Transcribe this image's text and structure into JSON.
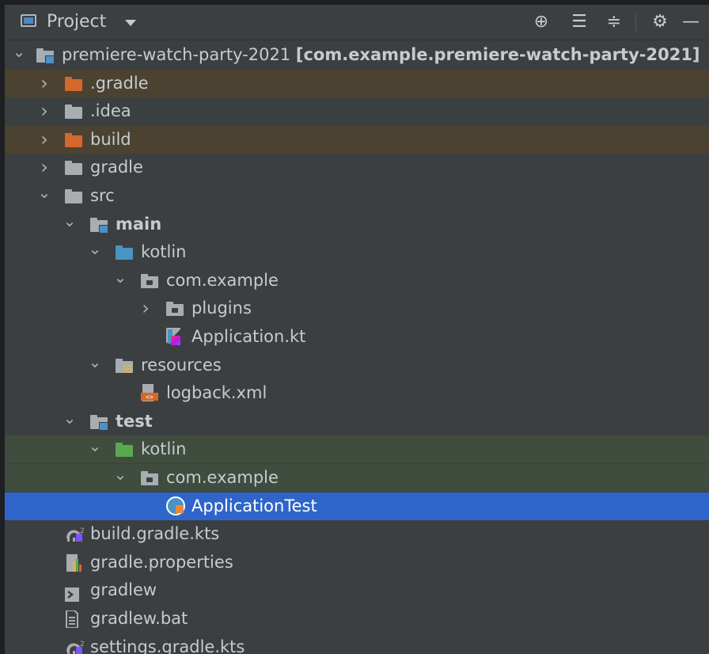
{
  "panel": {
    "title": "Project",
    "toolbar_icons": [
      "target-icon",
      "expand-all-icon",
      "collapse-all-icon",
      "gear-icon",
      "minimize-icon"
    ],
    "toolbar_glyphs": [
      "⊕",
      "☰",
      "≑",
      "⚙",
      "—"
    ]
  },
  "tree": [
    {
      "name": "premiere-watch-party-2021",
      "suffix": "[com.example.premiere-watch-party-2021]",
      "icon": "module-folder-icon",
      "expanded": true,
      "depth": 0
    },
    {
      "name": ".gradle",
      "icon": "folder-icon",
      "color": "#d3672c",
      "expanded": false,
      "depth": 1,
      "excluded": true
    },
    {
      "name": ".idea",
      "icon": "folder-icon",
      "color": "#a8adb2",
      "expanded": false,
      "depth": 1
    },
    {
      "name": "build",
      "icon": "folder-icon",
      "color": "#d3672c",
      "expanded": false,
      "depth": 1,
      "excluded": true
    },
    {
      "name": "gradle",
      "icon": "folder-icon",
      "color": "#a8adb2",
      "expanded": false,
      "depth": 1
    },
    {
      "name": "src",
      "icon": "folder-icon",
      "color": "#a8adb2",
      "expanded": true,
      "depth": 1
    },
    {
      "name": "main",
      "icon": "source-set-folder-icon",
      "expanded": true,
      "depth": 2,
      "bold": true
    },
    {
      "name": "kotlin",
      "icon": "source-root-folder-icon",
      "color": "#4894c4",
      "expanded": true,
      "depth": 3
    },
    {
      "name": "com.example",
      "icon": "package-icon",
      "expanded": true,
      "depth": 4
    },
    {
      "name": "plugins",
      "icon": "package-icon",
      "expanded": false,
      "depth": 5
    },
    {
      "name": "Application.kt",
      "icon": "kotlin-file-icon",
      "depth": 5
    },
    {
      "name": "resources",
      "icon": "resources-folder-icon",
      "expanded": true,
      "depth": 3
    },
    {
      "name": "logback.xml",
      "icon": "xml-file-icon",
      "depth": 4
    },
    {
      "name": "test",
      "icon": "source-set-folder-icon",
      "expanded": true,
      "depth": 2,
      "bold": true
    },
    {
      "name": "kotlin",
      "icon": "test-root-folder-icon",
      "color": "#5aa850",
      "expanded": true,
      "depth": 3,
      "test": true
    },
    {
      "name": "com.example",
      "icon": "package-icon",
      "expanded": true,
      "depth": 4,
      "test": true
    },
    {
      "name": "ApplicationTest",
      "icon": "test-class-icon",
      "depth": 5,
      "selected": true
    },
    {
      "name": "build.gradle.kts",
      "icon": "gradle-kts-icon",
      "depth": 1
    },
    {
      "name": "gradle.properties",
      "icon": "properties-file-icon",
      "depth": 1
    },
    {
      "name": "gradlew",
      "icon": "shell-script-icon",
      "depth": 1
    },
    {
      "name": "gradlew.bat",
      "icon": "text-file-icon",
      "depth": 1
    },
    {
      "name": "settings.gradle.kts",
      "icon": "gradle-kts-icon",
      "depth": 1
    }
  ]
}
